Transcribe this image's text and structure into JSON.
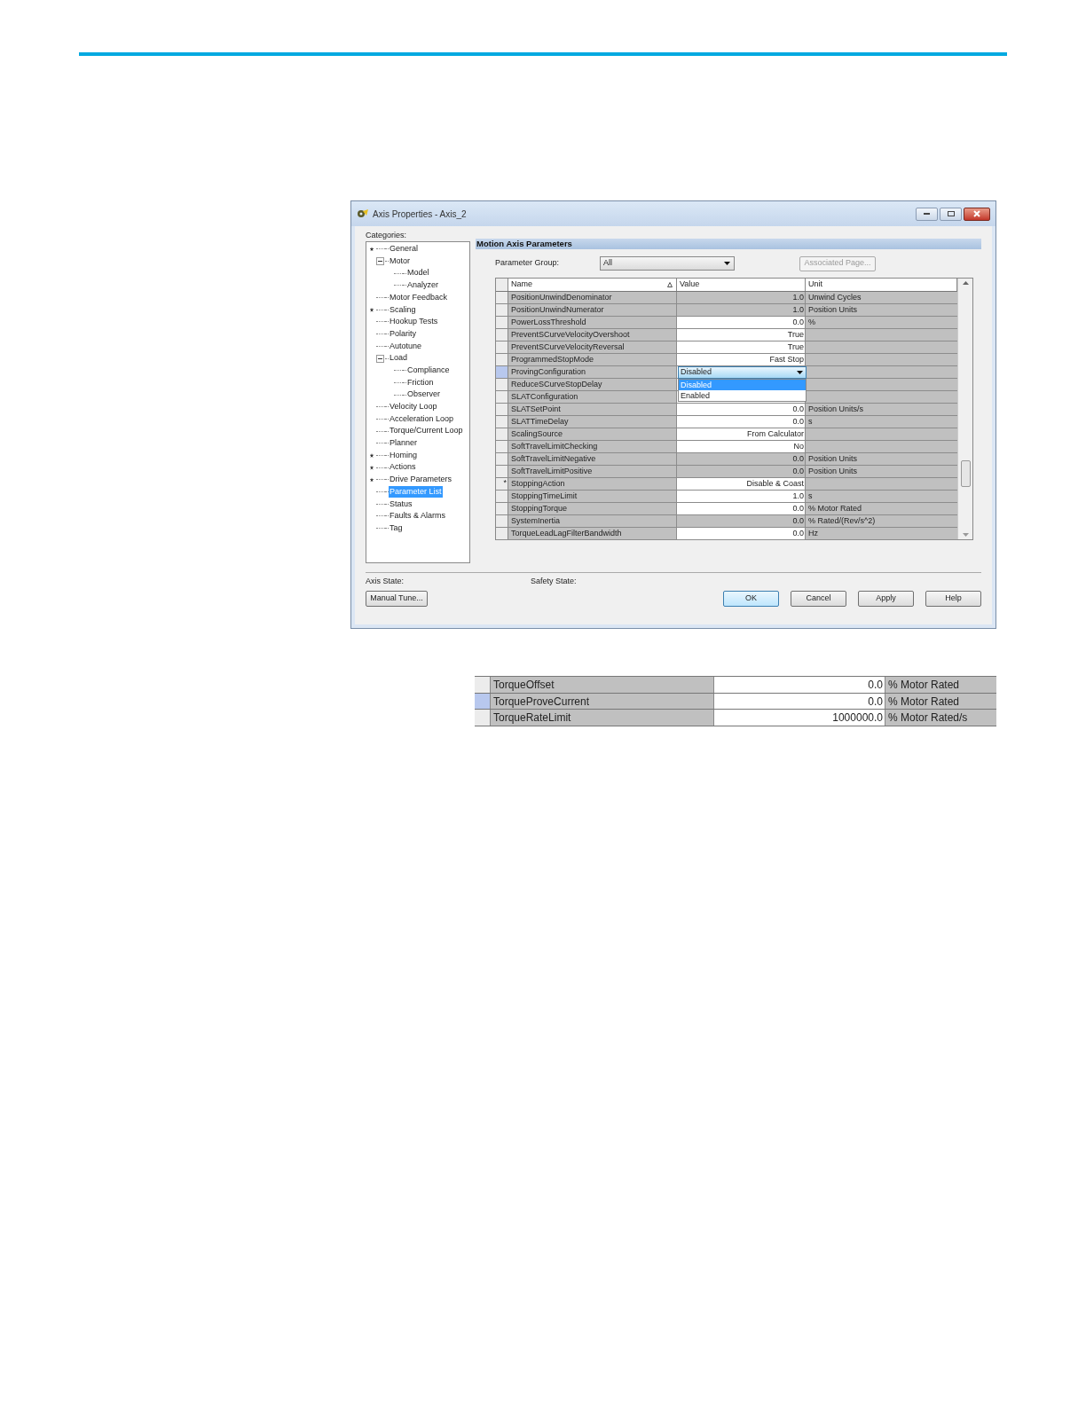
{
  "dialog": {
    "title": "Axis Properties - Axis_2",
    "categories_label": "Categories:",
    "tree": [
      {
        "label": "General",
        "modified": true,
        "selected": false
      },
      {
        "label": "Motor",
        "modified": false,
        "selected": false,
        "expanded": true,
        "children": [
          {
            "label": "Model",
            "modified": false,
            "selected": false
          },
          {
            "label": "Analyzer",
            "modified": false,
            "selected": false
          }
        ]
      },
      {
        "label": "Motor Feedback",
        "modified": false,
        "selected": false
      },
      {
        "label": "Scaling",
        "modified": true,
        "selected": false
      },
      {
        "label": "Hookup Tests",
        "modified": false,
        "selected": false
      },
      {
        "label": "Polarity",
        "modified": false,
        "selected": false
      },
      {
        "label": "Autotune",
        "modified": false,
        "selected": false
      },
      {
        "label": "Load",
        "modified": false,
        "selected": false,
        "expanded": true,
        "children": [
          {
            "label": "Compliance",
            "modified": false,
            "selected": false
          },
          {
            "label": "Friction",
            "modified": false,
            "selected": false
          },
          {
            "label": "Observer",
            "modified": false,
            "selected": false
          }
        ]
      },
      {
        "label": "Velocity Loop",
        "modified": false,
        "selected": false
      },
      {
        "label": "Acceleration Loop",
        "modified": false,
        "selected": false
      },
      {
        "label": "Torque/Current Loop",
        "modified": false,
        "selected": false
      },
      {
        "label": "Planner",
        "modified": false,
        "selected": false
      },
      {
        "label": "Homing",
        "modified": true,
        "selected": false
      },
      {
        "label": "Actions",
        "modified": true,
        "selected": false
      },
      {
        "label": "Drive Parameters",
        "modified": true,
        "selected": false
      },
      {
        "label": "Parameter List",
        "modified": false,
        "selected": true
      },
      {
        "label": "Status",
        "modified": false,
        "selected": false
      },
      {
        "label": "Faults & Alarms",
        "modified": false,
        "selected": false
      },
      {
        "label": "Tag",
        "modified": false,
        "selected": false
      }
    ],
    "panel_title": "Motion Axis Parameters",
    "parameter_group": {
      "label": "Parameter Group:",
      "value": "All"
    },
    "associated_page_button": "Associated Page...",
    "table": {
      "columns": [
        "Name",
        "Value",
        "Unit"
      ],
      "rows": [
        {
          "name": "PositionUnwindDenominator",
          "value": "1.0",
          "unit": "Unwind Cycles",
          "editable": false,
          "current": false
        },
        {
          "name": "PositionUnwindNumerator",
          "value": "1.0",
          "unit": "Position Units",
          "editable": false,
          "current": false
        },
        {
          "name": "PowerLossThreshold",
          "value": "0.0",
          "unit": "%",
          "editable": true,
          "current": false
        },
        {
          "name": "PreventSCurveVelocityOvershoot",
          "value": "True",
          "editable": true,
          "current": false
        },
        {
          "name": "PreventSCurveVelocityReversal",
          "value": "True",
          "editable": true,
          "current": false
        },
        {
          "name": "ProgrammedStopMode",
          "value": "Fast Stop",
          "editable": true,
          "current": false
        },
        {
          "name": "ProvingConfiguration",
          "editable": true,
          "current": true,
          "dropdown": {
            "value": "Disabled",
            "options": [
              {
                "label": "Disabled",
                "selected": true
              },
              {
                "label": "Enabled",
                "selected": false
              }
            ]
          }
        },
        {
          "name": "ReduceSCurveStopDelay",
          "editable": true,
          "current": false
        },
        {
          "name": "SLATConfiguration",
          "editable": true,
          "current": false
        },
        {
          "name": "SLATSetPoint",
          "value": "0.0",
          "unit": "Position Units/s",
          "editable": true,
          "current": false
        },
        {
          "name": "SLATTimeDelay",
          "value": "0.0",
          "unit": "s",
          "editable": true,
          "current": false
        },
        {
          "name": "ScalingSource",
          "value": "From Calculator",
          "editable": true,
          "current": false
        },
        {
          "name": "SoftTravelLimitChecking",
          "value": "No",
          "editable": true,
          "current": false
        },
        {
          "name": "SoftTravelLimitNegative",
          "value": "0.0",
          "unit": "Position Units",
          "editable": false,
          "current": false
        },
        {
          "name": "SoftTravelLimitPositive",
          "value": "0.0",
          "unit": "Position Units",
          "editable": false,
          "current": false
        },
        {
          "name": "StoppingAction",
          "mark": "*",
          "value": "Disable & Coast",
          "editable": true,
          "current": false
        },
        {
          "name": "StoppingTimeLimit",
          "value": "1.0",
          "unit": "s",
          "editable": true,
          "current": false
        },
        {
          "name": "StoppingTorque",
          "value": "0.0",
          "unit": "% Motor Rated",
          "editable": true,
          "current": false
        },
        {
          "name": "SystemInertia",
          "value": "0.0",
          "unit": "% Rated/(Rev/s^2)",
          "editable": false,
          "current": false
        },
        {
          "name": "TorqueLeadLagFilterBandwidth",
          "value": "0.0",
          "unit": "Hz",
          "editable": true,
          "current": false
        }
      ]
    },
    "axis_state_label": "Axis State:",
    "safety_state_label": "Safety State:",
    "manual_tune_button": "Manual Tune...",
    "buttons": [
      {
        "label": "OK",
        "default": true
      },
      {
        "label": "Cancel",
        "default": false
      },
      {
        "label": "Apply",
        "default": false
      },
      {
        "label": "Help",
        "default": false
      }
    ]
  },
  "excerpt": {
    "rows": [
      {
        "name": "TorqueOffset",
        "value": "0.0",
        "unit": "% Motor Rated",
        "editable": true,
        "current": false
      },
      {
        "name": "TorqueProveCurrent",
        "value": "0.0",
        "unit": "% Motor Rated",
        "editable": true,
        "current": true
      },
      {
        "name": "TorqueRateLimit",
        "value": "1000000.0",
        "unit": "% Motor Rated/s",
        "editable": true,
        "current": false
      }
    ]
  }
}
